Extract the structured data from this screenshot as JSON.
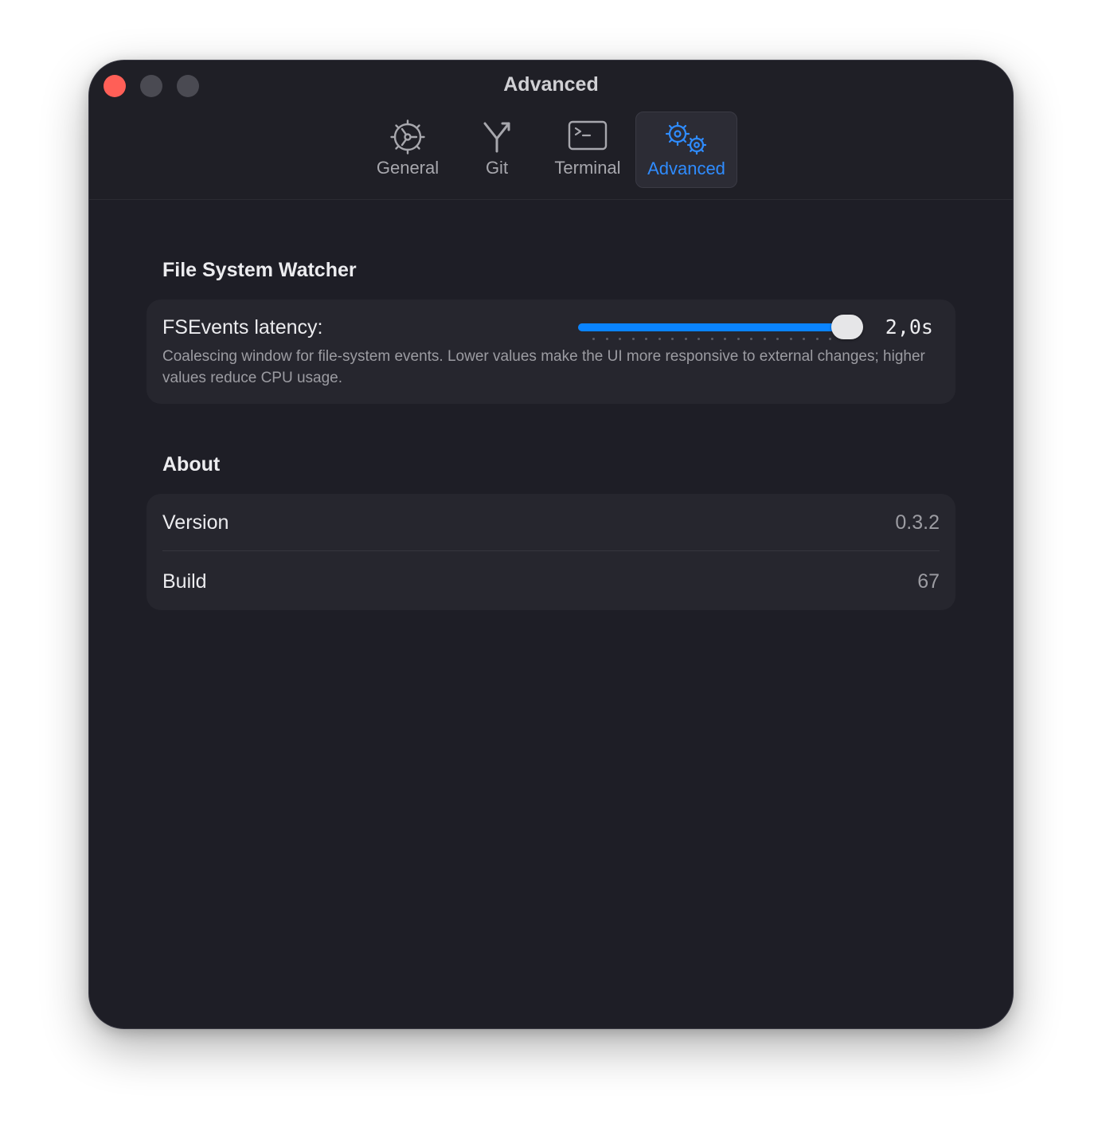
{
  "window": {
    "title": "Advanced"
  },
  "tabs": [
    {
      "label": "General",
      "icon": "gear-icon"
    },
    {
      "label": "Git",
      "icon": "branch-icon"
    },
    {
      "label": "Terminal",
      "icon": "terminal-icon"
    },
    {
      "label": "Advanced",
      "icon": "gears-icon",
      "active": true
    }
  ],
  "file_system_watcher": {
    "title": "File System Watcher",
    "latency": {
      "label": "FSEvents latency:",
      "value_text": "2,0s",
      "slider_fraction": 1.0,
      "description": "Coalescing window for file-system events. Lower values make the UI more responsive to external changes; higher values reduce CPU usage."
    }
  },
  "about": {
    "title": "About",
    "rows": [
      {
        "label": "Version",
        "value": "0.3.2"
      },
      {
        "label": "Build",
        "value": "67"
      }
    ]
  },
  "colors": {
    "accent": "#0a84ff",
    "window_bg": "#1e1e26",
    "card_bg": "#26262e",
    "close": "#ff5f57"
  }
}
